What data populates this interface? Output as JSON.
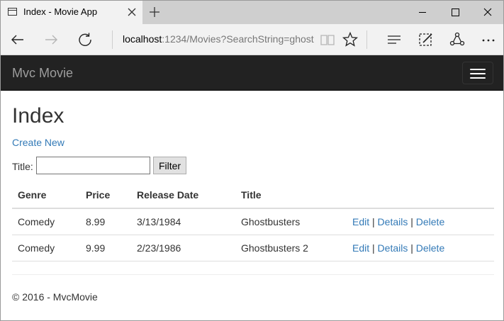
{
  "browser": {
    "tab_title": "Index - Movie App",
    "url_host": "localhost",
    "url_rest": ":1234/Movies?SearchString=ghost"
  },
  "icons": [
    "tab-page-icon",
    "tab-close-icon",
    "new-tab-icon",
    "minimize-icon",
    "maximize-icon",
    "window-close-icon",
    "back-icon",
    "forward-icon",
    "refresh-icon",
    "reading-view-icon",
    "favorite-star-icon",
    "hub-icon",
    "web-note-icon",
    "share-icon",
    "more-icon",
    "hamburger-icon"
  ],
  "navbar": {
    "brand": "Mvc Movie"
  },
  "page": {
    "title": "Index",
    "create_new": "Create New",
    "search_label": "Title:",
    "search_value": "",
    "filter_button": "Filter"
  },
  "table": {
    "headers": [
      "Genre",
      "Price",
      "Release Date",
      "Title"
    ],
    "rows": [
      {
        "genre": "Comedy",
        "price": "8.99",
        "release_date": "3/13/1984",
        "title": "Ghostbusters",
        "edit": "Edit",
        "details": "Details",
        "delete": "Delete"
      },
      {
        "genre": "Comedy",
        "price": "9.99",
        "release_date": "2/23/1986",
        "title": "Ghostbusters 2",
        "edit": "Edit",
        "details": "Details",
        "delete": "Delete"
      }
    ],
    "separator": "|"
  },
  "footer": "© 2016 - MvcMovie",
  "colors": {
    "navbar": "#222222",
    "brand": "#9d9d9d",
    "link": "#337ab7",
    "text": "#333333"
  }
}
